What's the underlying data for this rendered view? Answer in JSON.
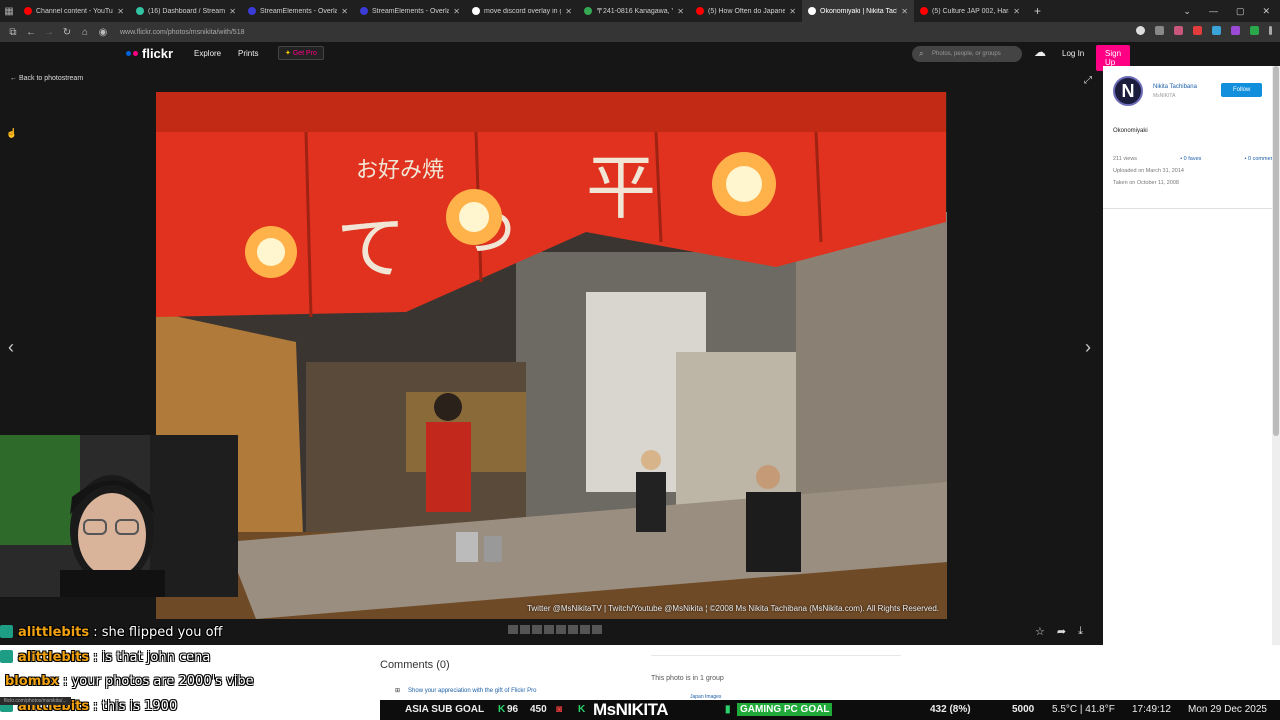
{
  "browser": {
    "tabs": [
      {
        "title": "Channel content - YouTube Stu",
        "color": "#ff0000"
      },
      {
        "title": "(16) Dashboard / Streamlabs",
        "color": "#31c3a2"
      },
      {
        "title": "StreamElements - Overlays",
        "color": "#3b3bd6"
      },
      {
        "title": "StreamElements - Overlays",
        "color": "#3b3bd6"
      },
      {
        "title": "move discord overlay in games",
        "color": "#ffffff"
      },
      {
        "title": "〒241-0816 Kanagawa, Yokoha",
        "color": "#34a853"
      },
      {
        "title": "(5) How Often do Japanese Pe",
        "color": "#ff0000"
      },
      {
        "title": "Okonomiyaki | Nikita Tachibana",
        "color": "#ffffff",
        "active": true
      },
      {
        "title": "(5) Culture JAP 002, Harajuku g",
        "color": "#ff0000"
      }
    ],
    "new_tab": "+",
    "url": "www.flickr.com/photos/msnikita/with/518"
  },
  "flickr": {
    "logo": "flickr",
    "nav": {
      "explore": "Explore",
      "prints": "Prints",
      "get_pro": "Get Pro"
    },
    "search_placeholder": "Photos, people, or groups",
    "login": "Log In",
    "signup": "Sign Up",
    "back": "Back to photostream",
    "photo_credit": "Twitter @MsNikitaTV | Twitch/Youtube @MsNikita ¦ ©2008 Ms Nikita Tachibana (MsNikita.com). All Rights Reserved.",
    "sidebar": {
      "avatar_letter": "N",
      "name": "Nikita Tachibana",
      "handle": "MsNIKITA",
      "follow": "Follow",
      "title": "Okonomiyaki",
      "views": "211 views",
      "faves": "0 faves",
      "comments": "0 comments",
      "uploaded": "Uploaded on March 31, 2014",
      "taken": "Taken on October 11, 2008"
    },
    "comments_heading": "Comments (0)",
    "appreciate": "Show your appreciation with the gift of Flickr Pro",
    "group_text": "This photo is in 1 group",
    "group_link": "Japan Images"
  },
  "chat": [
    {
      "user": "alittlebits",
      "msg": " : she flipped you off"
    },
    {
      "user": "alittlebits",
      "msg": " : is that john cena"
    },
    {
      "user": "blombx",
      "msg": " : your photos are 2000's vibe"
    },
    {
      "user": "alittlebits",
      "msg": " : this is 1900"
    }
  ],
  "ticker": {
    "goal": "ASIA SUB GOAL",
    "goal_count": "96",
    "goal_target": "450",
    "brand": "MsNIKITA",
    "gaming": "GAMING PC GOAL",
    "pc_progress": "432 (8%)",
    "pc_target": "5000",
    "weather": "5.5°C | 41.8°F",
    "time": "17:49:12",
    "date": "Mon 29 Dec 2025"
  }
}
